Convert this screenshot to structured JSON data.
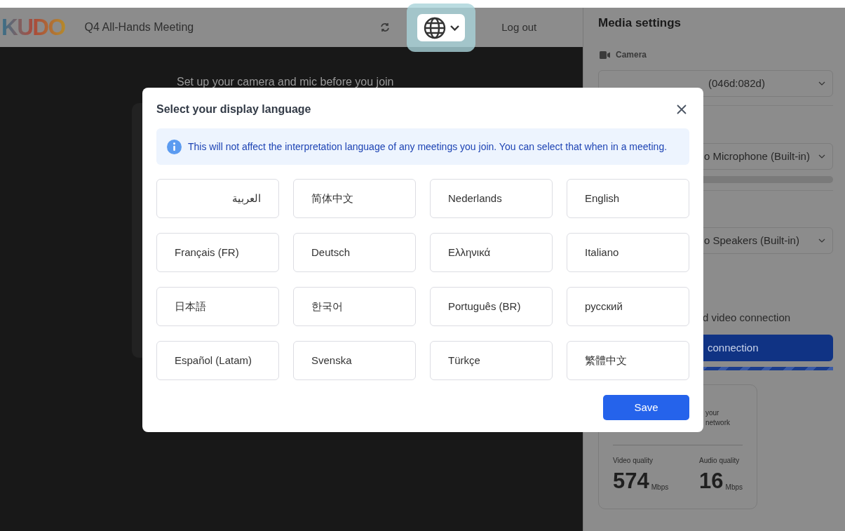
{
  "header": {
    "logo": "KUDO",
    "meeting_title": "Q4 All-Hands Meeting",
    "logout": "Log out"
  },
  "preview": {
    "prompt": "Set up your camera and mic before you join"
  },
  "media_settings": {
    "title": "Media settings",
    "camera_label": "Camera",
    "camera_device": "(046d:082d)",
    "microphone_device": "o Microphone (Built-in)",
    "speaker_device": "o Speakers (Built-in)",
    "connection_text": "d video connection",
    "connection_button": "connection",
    "connection_progress": {
      "level": 1
    },
    "tip_lines": [
      "your",
      "network"
    ],
    "qualities": [
      {
        "label": "Video quality",
        "value": "574",
        "unit": "Mbps"
      },
      {
        "label": "Audio quality",
        "value": "16",
        "unit": "Mbps"
      }
    ]
  },
  "dialog": {
    "title": "Select your display language",
    "notice": "This will not affect the interpretation language of any meetings you join. You can select that when in a meeting.",
    "languages": [
      "العربية",
      "简体中文",
      "Nederlands",
      "English",
      "Français (FR)",
      "Deutsch",
      "Ελληνικά",
      "Italiano",
      "日本語",
      "한국어",
      "Português (BR)",
      "русский",
      "Español (Latam)",
      "Svenska",
      "Türkçe",
      "繁體中文"
    ],
    "save": "Save"
  }
}
